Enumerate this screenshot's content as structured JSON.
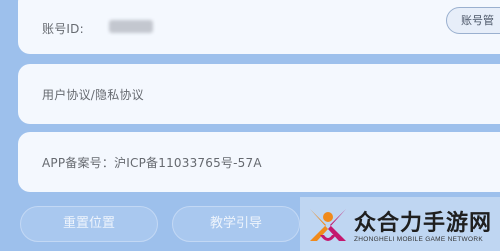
{
  "account": {
    "id_label": "账号ID:",
    "button_label": "账号管"
  },
  "agreement": {
    "label": "用户协议/隐私协议"
  },
  "icp": {
    "label": "APP备案号：沪ICP备11033765号-57A"
  },
  "buttons": {
    "reset_label": "重置位置",
    "tutorial_label": "教学引导"
  },
  "watermark": {
    "title": "众合力手游网",
    "subtitle": "ZHONGHELI MOBILE GAME NETWORK"
  },
  "colors": {
    "background": "#9dc0ec",
    "card": "#f4f8fe",
    "button_fill": "#a9c8ef",
    "logo_orange": "#f08a1c",
    "logo_magenta": "#c4176e"
  }
}
